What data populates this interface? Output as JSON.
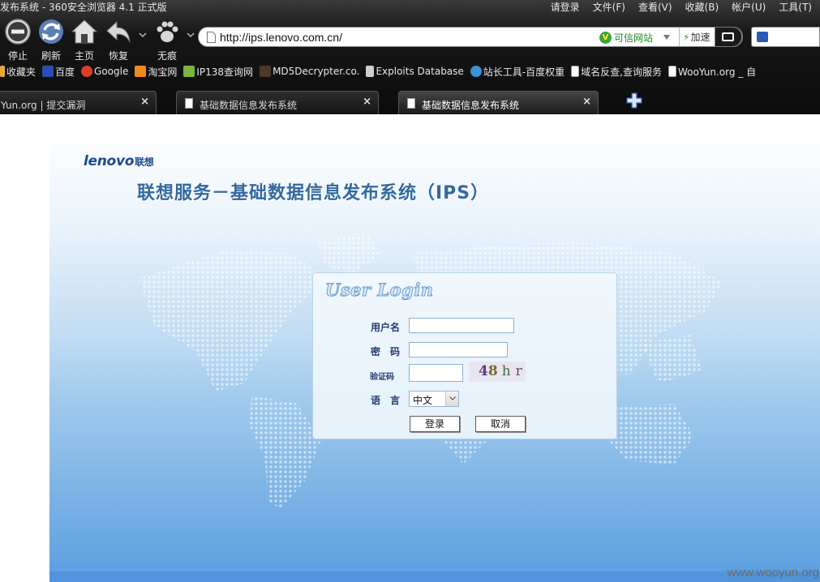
{
  "browser": {
    "window_title": "发布系统 - 360安全浏览器 4.1 正式版",
    "menu": [
      "请登录",
      "文件(F)",
      "查看(V)",
      "收藏(B)",
      "帐户(U)",
      "工具(T)"
    ],
    "nav_buttons": {
      "stop": "停止",
      "refresh": "刷新",
      "home": "主页",
      "restore": "恢复",
      "incognito": "无痕"
    },
    "address": {
      "url": "http://ips.lenovo.com.cn/",
      "trusted_label": "可信网站",
      "accelerate_label": "加速"
    },
    "bookmarks": [
      "收藏夹",
      "百度",
      "Google",
      "淘宝网",
      "IP138查询网",
      "MD5Decrypter.co.",
      "Exploits Database",
      "站长工具-百度权重",
      "域名反查,查询服务",
      "WooYun.org _ 自"
    ],
    "tabs": [
      {
        "title": "Yun.org | 提交漏洞",
        "close": "×"
      },
      {
        "title": "基础数据信息发布系统",
        "close": "×"
      },
      {
        "title": "基础数据信息发布系统",
        "close": "×"
      }
    ]
  },
  "page": {
    "brand_logo": "lenovo",
    "brand_logo_cn": "联想",
    "system_title": "联想服务－基础数据信息发布系统（IPS）",
    "login": {
      "title": "User Login",
      "username_label": "用户名",
      "password_label": "密　码",
      "captcha_label": "验证码",
      "captcha_chars": [
        "4",
        "8",
        "h",
        "r"
      ],
      "language_label": "语　言",
      "language_value": "中文",
      "submit_button": "登录",
      "cancel_button": "取消"
    }
  },
  "watermark": "www.wooyun.org"
}
